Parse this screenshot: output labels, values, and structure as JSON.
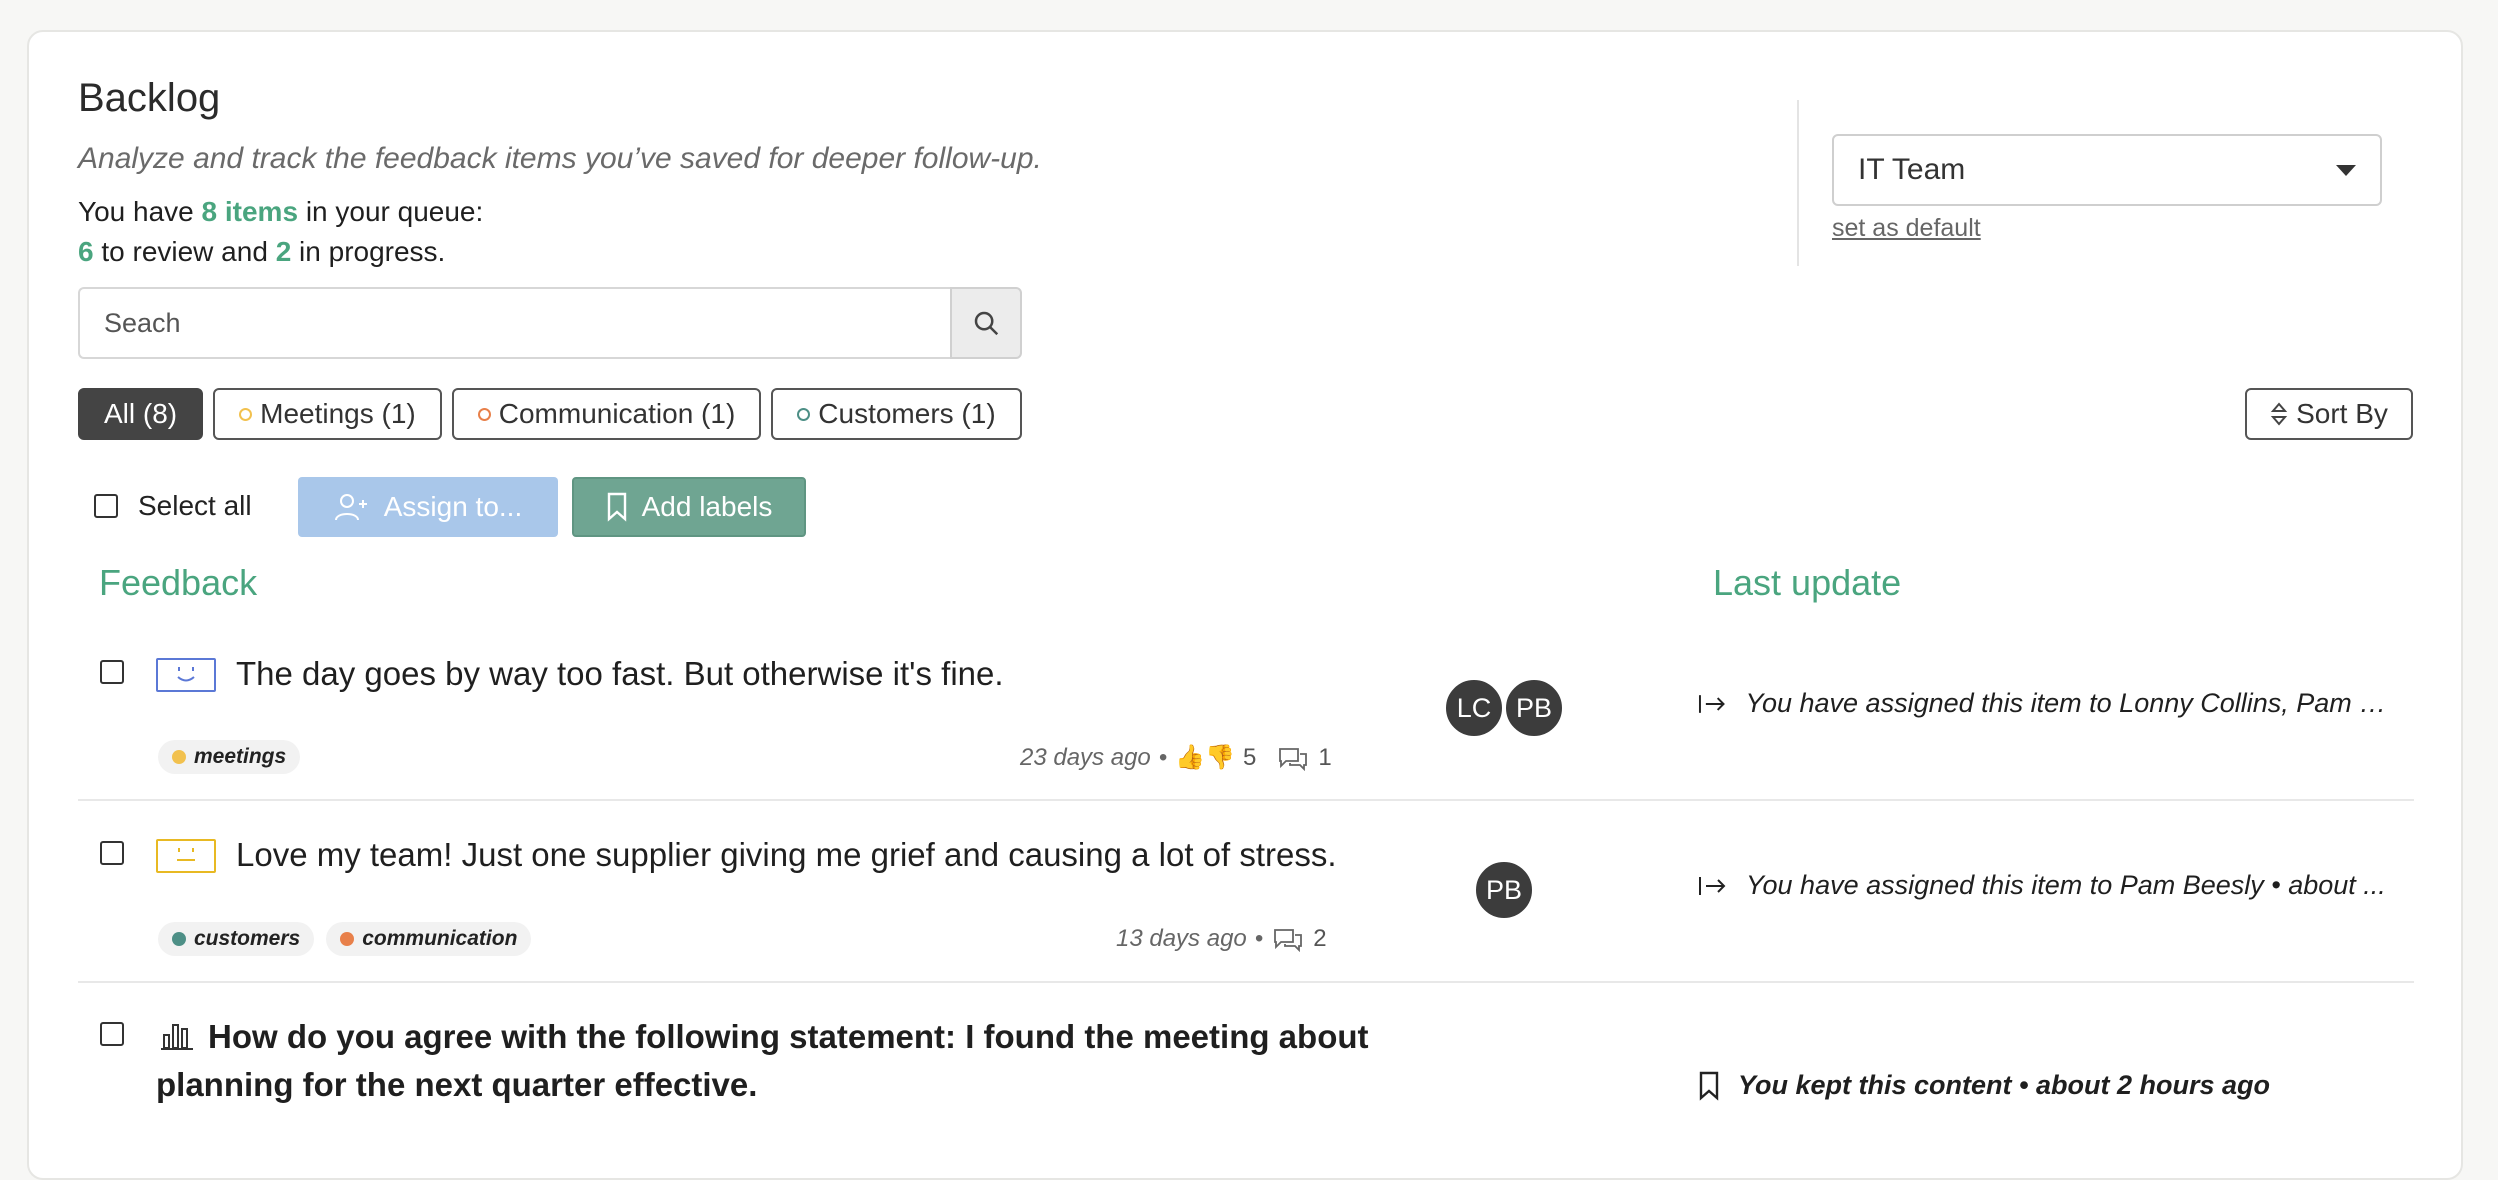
{
  "header": {
    "title": "Backlog",
    "subtitle": "Analyze and track the feedback items you’ve saved for deeper follow-up.",
    "queue_prefix": "You have",
    "queue_items": "8 items",
    "queue_suffix": "in your queue:",
    "review_count": "6",
    "review_text": "to review and",
    "progress_count": "2",
    "progress_text": "in progress."
  },
  "search": {
    "placeholder": "Seach"
  },
  "team": {
    "selected": "IT Team",
    "set_default": "set as default"
  },
  "filters": [
    {
      "label": "All (8)",
      "active": true,
      "color": ""
    },
    {
      "label": "Meetings (1)",
      "active": false,
      "color": "#f2c14e"
    },
    {
      "label": "Communication (1)",
      "active": false,
      "color": "#e8804a"
    },
    {
      "label": "Customers (1)",
      "active": false,
      "color": "#4d8f86"
    }
  ],
  "sort_label": "Sort By",
  "actions": {
    "select_all": "Select all",
    "assign": "Assign to...",
    "add_labels": "Add labels"
  },
  "columns": {
    "feedback": "Feedback",
    "last_update": "Last update"
  },
  "rows": [
    {
      "text": "The day goes by way too fast. But otherwise it's fine.",
      "mood_color": "#5b78d6",
      "tags": [
        {
          "label": "meetings",
          "color": "#f2c14e"
        }
      ],
      "age": "23 days ago",
      "reactions": "5",
      "comments": "1",
      "avatars": [
        "LC",
        "PB"
      ],
      "update": "You have assigned this item to Lonny Collins, Pam B..."
    },
    {
      "text": "Love my team! Just one supplier giving me grief and causing a lot of stress.",
      "mood_color": "#e8b923",
      "tags": [
        {
          "label": "customers",
          "color": "#4d8f86"
        },
        {
          "label": "communication",
          "color": "#e8804a"
        }
      ],
      "age": "13 days ago",
      "comments": "2",
      "avatars": [
        "PB"
      ],
      "update": "You have assigned this item to Pam Beesly  • about ..."
    },
    {
      "text_line1": "How do you agree with the following statement: I found the meeting about",
      "text_line2": "planning for the next quarter effective.",
      "update": "You kept this content  • about 2 hours ago"
    }
  ],
  "colors": {
    "accent_green": "#4aa57f",
    "assign_blue": "#a9c7ea",
    "labels_green": "#6fa592"
  }
}
